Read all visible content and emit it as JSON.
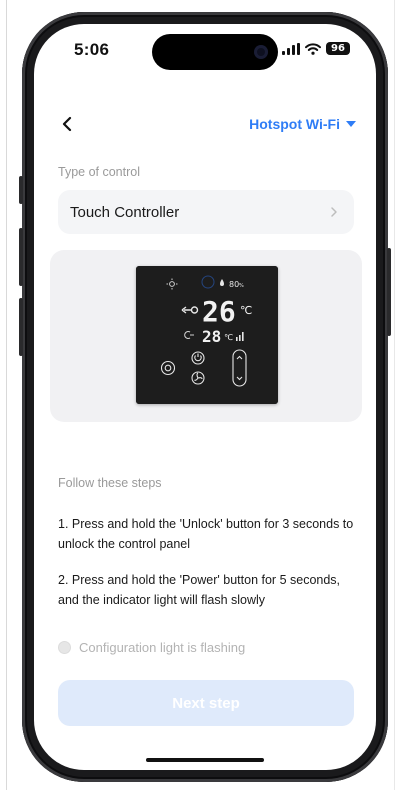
{
  "status_bar": {
    "time": "5:06",
    "battery": "96"
  },
  "header": {
    "network_label": "Hotspot Wi-Fi"
  },
  "control": {
    "section_label": "Type of control",
    "selected": "Touch Controller"
  },
  "device_display": {
    "temp_main": "26",
    "temp_unit": "℃",
    "temp_secondary": "28",
    "humidity": "80"
  },
  "steps": {
    "section_label": "Follow these steps",
    "step1": "1. Press and hold the 'Unlock' button for 3 seconds to unlock the control panel",
    "step2": "2. Press and hold the 'Power' button for 5 seconds, and the indicator light will flash slowly"
  },
  "confirm": {
    "label": "Configuration light is flashing",
    "checked": false
  },
  "footer": {
    "next_label": "Next step"
  },
  "colors": {
    "accent": "#2f7df6",
    "button_disabled": "#dfeafb",
    "card_bg": "#f4f5f7"
  }
}
